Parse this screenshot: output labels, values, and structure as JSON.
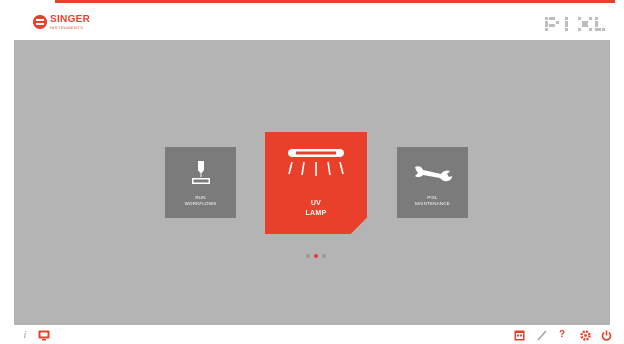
{
  "header": {
    "brand": "SINGER",
    "brand_sub": "INSTRUMENTS",
    "logo_icon": "singer-logo-icon",
    "product_logo_icon": "pixl-logo-icon",
    "accent_color": "#e8402a"
  },
  "tiles": [
    {
      "icon": "dispenser-icon",
      "label_line1": "RUN",
      "label_line2": "WORKFLOWS",
      "selected": false
    },
    {
      "icon": "uv-lamp-icon",
      "label_line1": "UV",
      "label_line2": "LAMP",
      "selected": true
    },
    {
      "icon": "wrench-icon",
      "label_line1": "PIXL",
      "label_line2": "MAINTENANCE",
      "selected": false
    }
  ],
  "pagination": {
    "total": 3,
    "current": 2
  },
  "footer": {
    "left": [
      {
        "icon": "info-icon",
        "text": "i"
      },
      {
        "icon": "monitor-icon"
      }
    ],
    "right": [
      {
        "icon": "calendar-icon"
      },
      {
        "icon": "pencil-icon"
      },
      {
        "icon": "help-icon",
        "text": "?"
      },
      {
        "icon": "settings-icon"
      },
      {
        "icon": "power-icon"
      }
    ]
  }
}
